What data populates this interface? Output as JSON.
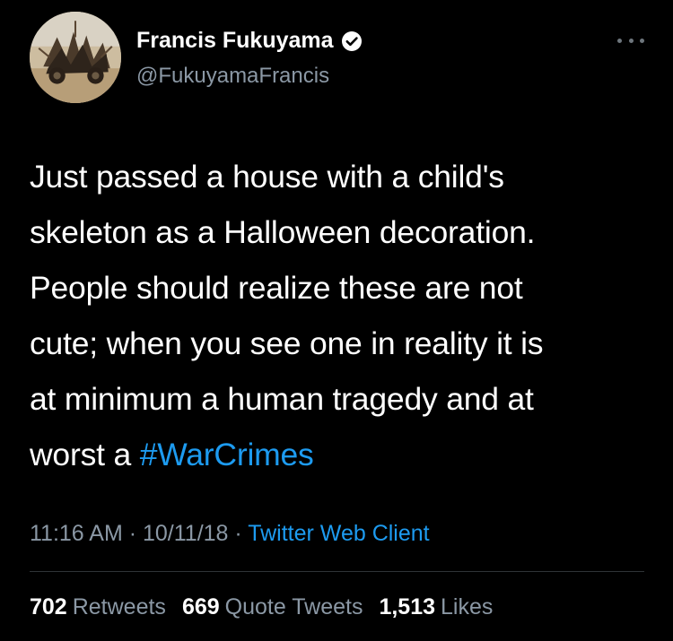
{
  "user": {
    "display_name": "Francis Fukuyama",
    "handle": "@FukuyamaFrancis",
    "verified": true
  },
  "tweet": {
    "lines": [
      "Just passed a house with a child's",
      "skeleton as a Halloween decoration.",
      "People should realize these are not",
      "cute; when you see one in reality it is",
      "at minimum a human tragedy and at"
    ],
    "last_line_prefix": "worst a ",
    "hashtag": "#WarCrimes"
  },
  "meta": {
    "time": "11:16 AM",
    "sep1": " · ",
    "date": "10/11/18",
    "sep2": " · ",
    "client": "Twitter Web Client"
  },
  "stats": {
    "retweets_count": "702",
    "retweets_label": "Retweets",
    "quotes_count": "669",
    "quotes_label": "Quote Tweets",
    "likes_count": "1,513",
    "likes_label": "Likes"
  },
  "colors": {
    "background": "#000000",
    "text": "#ffffff",
    "secondary": "#8b98a5",
    "link": "#1d9bf0",
    "divider": "#2f3336"
  },
  "icons": {
    "verified": "verified-badge-icon",
    "more": "more-options-icon"
  }
}
